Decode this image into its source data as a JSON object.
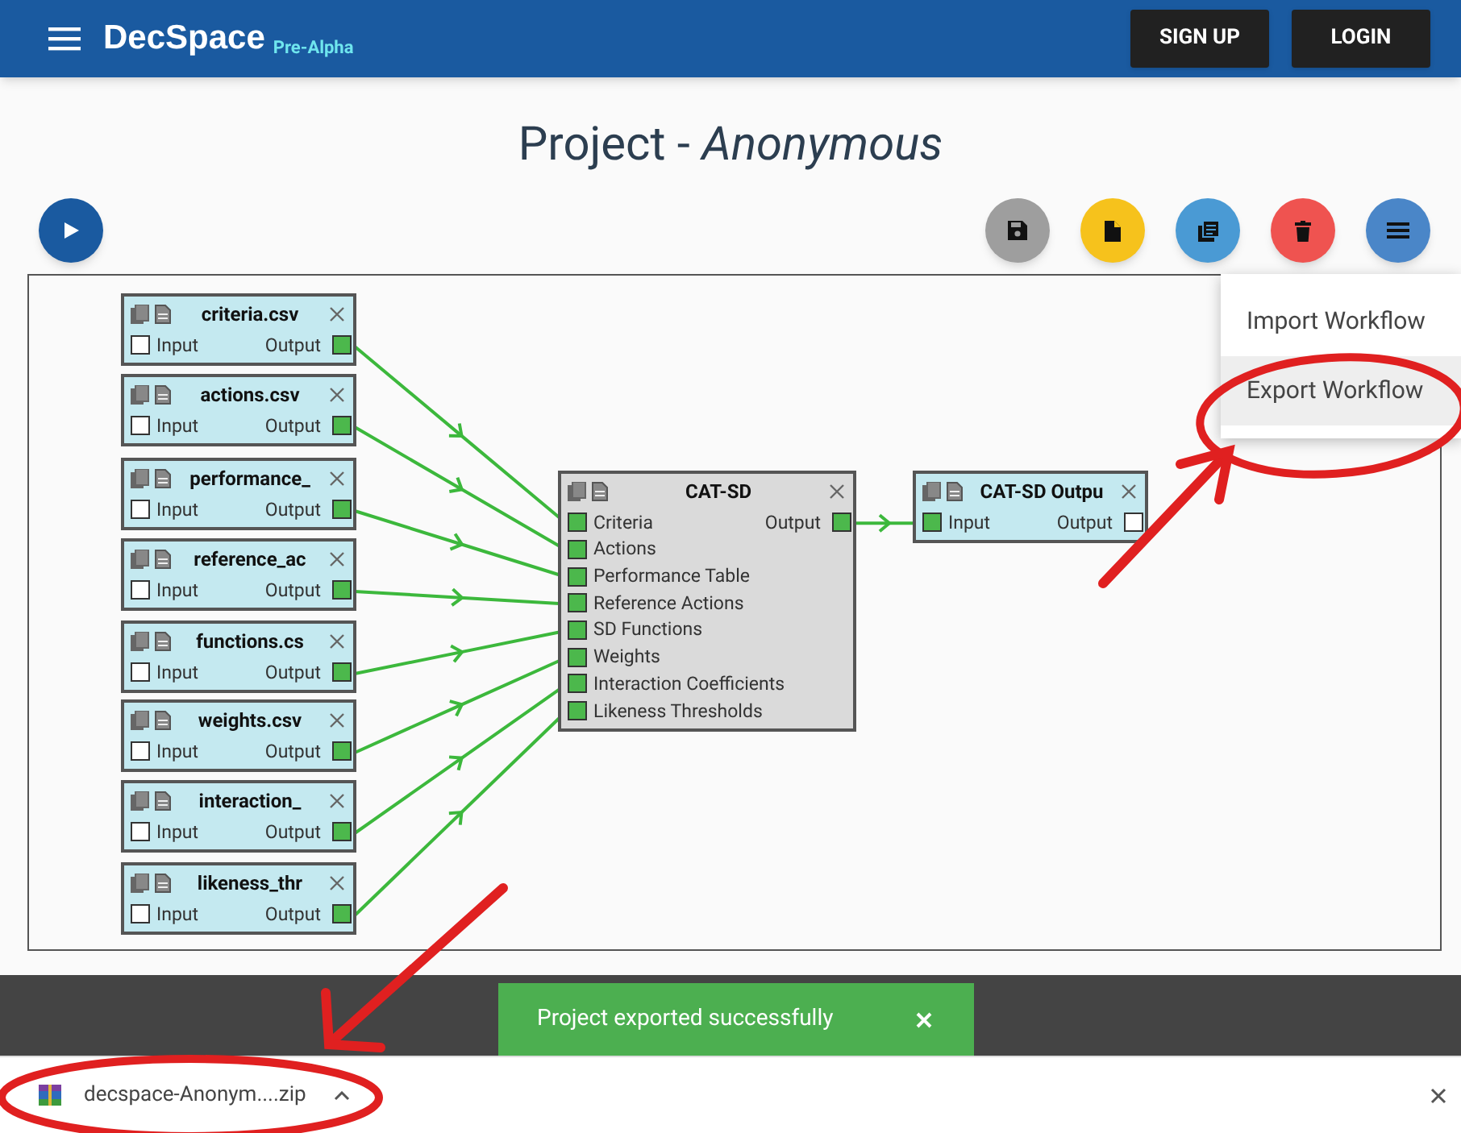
{
  "app": {
    "name": "DecSpace",
    "badge": "Pre-Alpha",
    "actions": [
      "SIGN UP",
      "LOGIN"
    ]
  },
  "title": "Project - *Anonymous*",
  "workflow_menu": [
    {
      "label": "Import Workflow",
      "highlighted": false
    },
    {
      "label": "Export Workflow",
      "highlighted": true
    }
  ],
  "nodes": [
    {
      "kind": "file",
      "title": "criteria.csv",
      "inputs": [
        {
          "label": "Input",
          "connected": false
        }
      ],
      "output": {
        "label": "Output",
        "connected": true
      }
    },
    {
      "kind": "file",
      "title": "actions.csv",
      "inputs": [
        {
          "label": "Input",
          "connected": false
        }
      ],
      "output": {
        "label": "Output",
        "connected": true
      }
    },
    {
      "kind": "file",
      "title": "performance_",
      "inputs": [
        {
          "label": "Input",
          "connected": false
        }
      ],
      "output": {
        "label": "Output",
        "connected": true
      }
    },
    {
      "kind": "file",
      "title": "reference_ac",
      "inputs": [
        {
          "label": "Input",
          "connected": false
        }
      ],
      "output": {
        "label": "Output",
        "connected": true
      }
    },
    {
      "kind": "file",
      "title": "functions.cs",
      "inputs": [
        {
          "label": "Input",
          "connected": false
        }
      ],
      "output": {
        "label": "Output",
        "connected": true
      }
    },
    {
      "kind": "file",
      "title": "weights.csv",
      "inputs": [
        {
          "label": "Input",
          "connected": false
        }
      ],
      "output": {
        "label": "Output",
        "connected": true
      }
    },
    {
      "kind": "file",
      "title": "interaction_",
      "inputs": [
        {
          "label": "Input",
          "connected": false
        }
      ],
      "output": {
        "label": "Output",
        "connected": true
      }
    },
    {
      "kind": "file",
      "title": "likeness_thr",
      "inputs": [
        {
          "label": "Input",
          "connected": false
        }
      ],
      "output": {
        "label": "Output",
        "connected": true
      }
    },
    {
      "kind": "algorithm",
      "title": "CAT-SD",
      "inputs": [
        {
          "label": "Criteria",
          "connected": true
        },
        {
          "label": "Actions",
          "connected": true
        },
        {
          "label": "Performance Table",
          "connected": true
        },
        {
          "label": "Reference Actions",
          "connected": true
        },
        {
          "label": "SD Functions",
          "connected": true
        },
        {
          "label": "Weights",
          "connected": true
        },
        {
          "label": "Interaction Coefficients",
          "connected": true
        },
        {
          "label": "Likeness Thresholds",
          "connected": true
        }
      ],
      "output": {
        "label": "Output",
        "connected": true
      }
    },
    {
      "kind": "file",
      "title": "CAT-SD Outpu",
      "inputs": [
        {
          "label": "Input",
          "connected": true
        }
      ],
      "output": {
        "label": "Output",
        "connected": false
      }
    }
  ],
  "toast": {
    "message": "Project exported successfully"
  },
  "download": {
    "file": "decspace-Anonym....zip"
  }
}
